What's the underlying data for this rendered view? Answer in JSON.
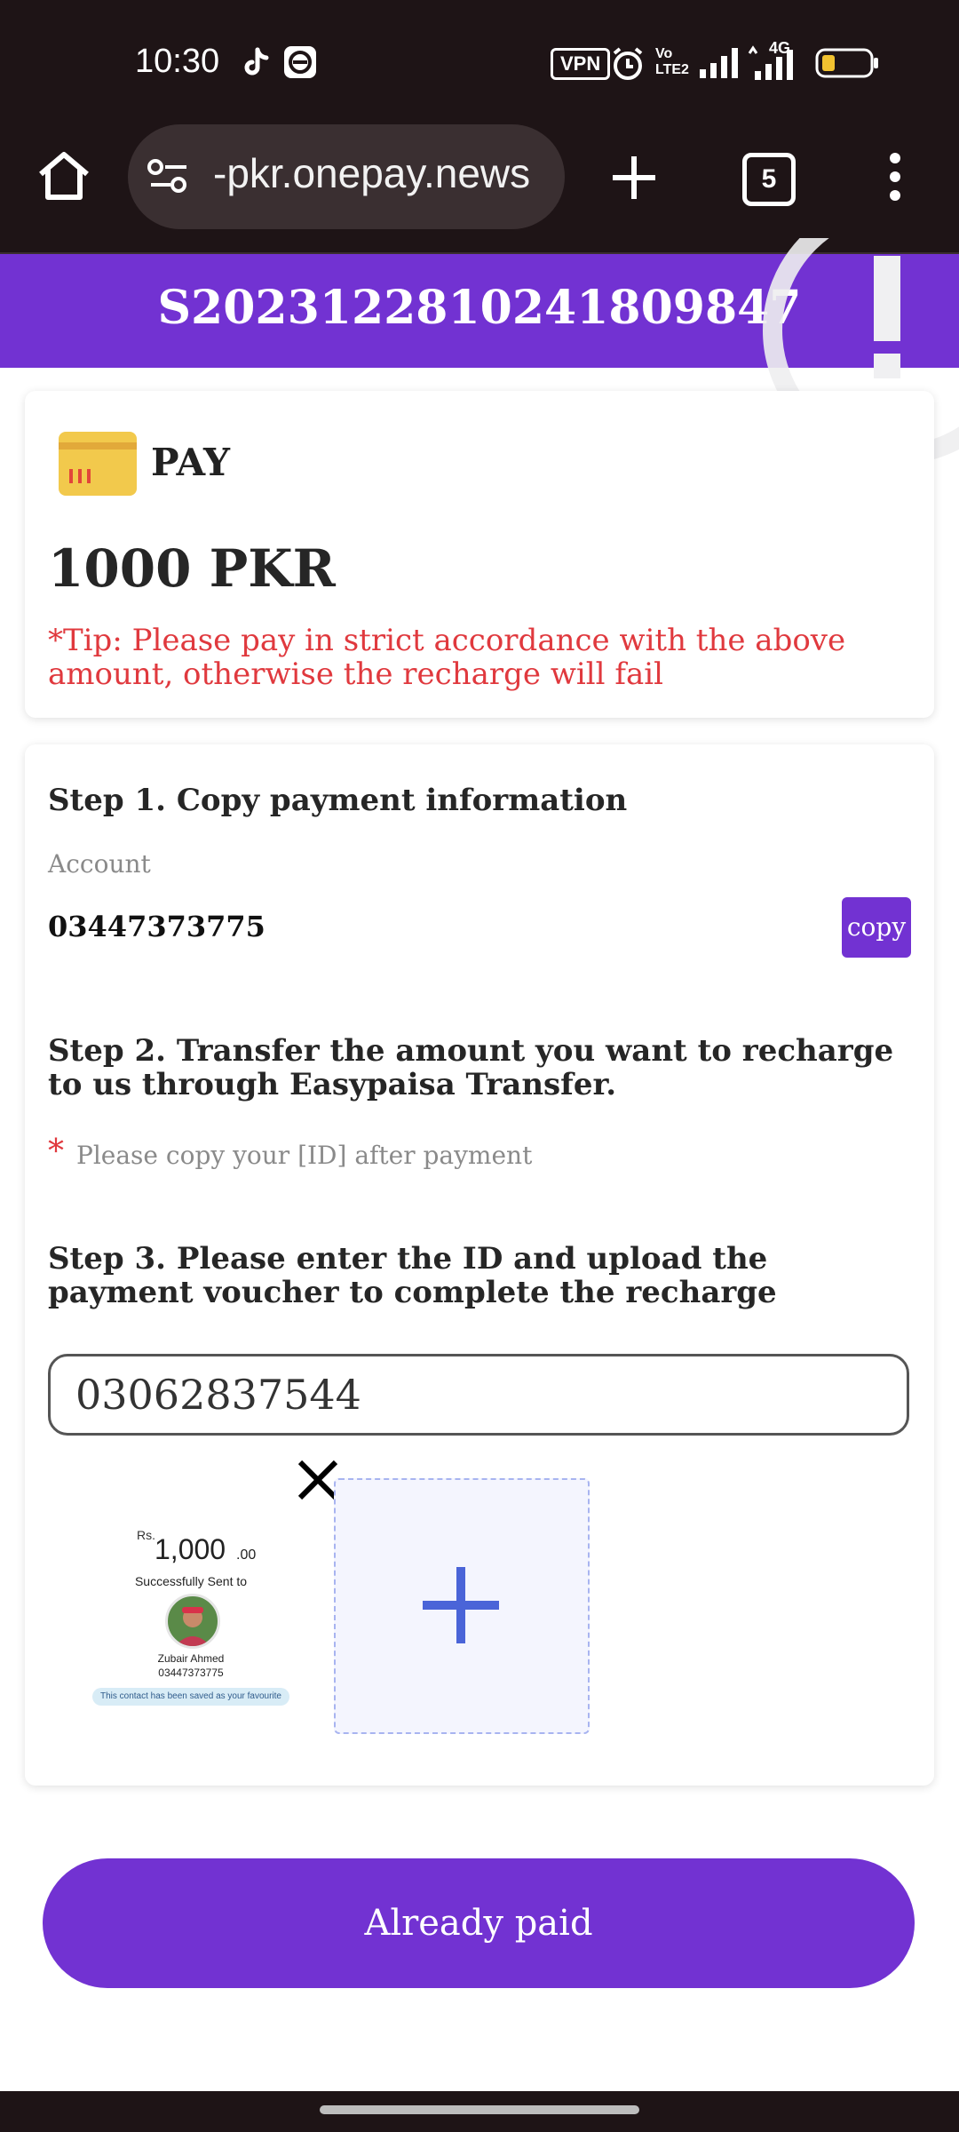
{
  "status_bar": {
    "time": "10:30",
    "vpn_label": "VPN",
    "volte_label": "Vo LTE2",
    "network_label": "4G"
  },
  "browser": {
    "url": "-pkr.onepay.news",
    "tab_count": "5"
  },
  "header": {
    "order_id": "S2023122810241809847"
  },
  "pay_card": {
    "title": "PAY",
    "amount": "1000 PKR",
    "tip": "*Tip: Please pay in strict accordance with the above amount, otherwise the recharge will fail"
  },
  "steps": {
    "step1_title": "Step 1. Copy payment information",
    "account_label": "Account",
    "account_value": "03447373775",
    "copy_label": "copy",
    "step2_title": "Step 2. Transfer the amount you want to recharge to us through Easypaisa Transfer.",
    "required_mark": "*",
    "step2_note": "Please copy your [ID] after payment",
    "step3_title": "Step 3. Please enter the ID and upload the payment voucher to complete the recharge",
    "id_value": "03062837544"
  },
  "voucher": {
    "currency_prefix": "Rs.",
    "amount": "1,000",
    "decimals": ".00",
    "sent_text": "Successfully Sent to",
    "recipient_name": "Zubair Ahmed",
    "recipient_number": "03447373775",
    "saved_note": "This contact has been saved as your favourite"
  },
  "actions": {
    "already_paid_label": "Already paid"
  },
  "colors": {
    "brand_purple": "#7232d2",
    "tip_red": "#e0393e",
    "plus_blue": "#4a64d8",
    "chrome_dark": "#1e1416"
  }
}
